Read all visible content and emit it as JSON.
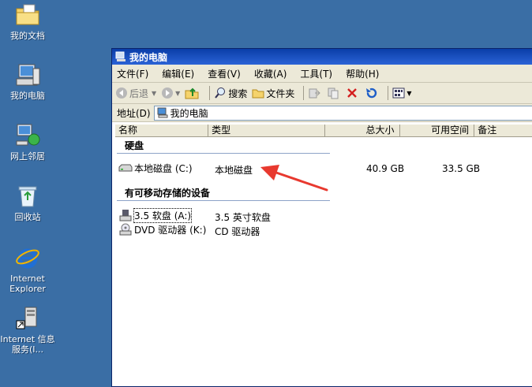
{
  "desktop": {
    "icons": [
      {
        "label": "我的文档"
      },
      {
        "label": "我的电脑"
      },
      {
        "label": "网上邻居"
      },
      {
        "label": "回收站"
      },
      {
        "label": "Internet Explorer"
      },
      {
        "label": "Internet 信息服务(I..."
      }
    ]
  },
  "window": {
    "title": "我的电脑",
    "menu": [
      "文件(F)",
      "编辑(E)",
      "查看(V)",
      "收藏(A)",
      "工具(T)",
      "帮助(H)"
    ],
    "toolbar": {
      "back_label": "后退",
      "search_label": "搜索",
      "folders_label": "文件夹"
    },
    "address": {
      "label": "地址(D)",
      "value": "我的电脑"
    },
    "columns": [
      "名称",
      "类型",
      "总大小",
      "可用空间",
      "备注"
    ],
    "groups": [
      {
        "title": "硬盘",
        "items": [
          {
            "name": "本地磁盘 (C:)",
            "type": "本地磁盘",
            "total": "40.9 GB",
            "free": "33.5 GB"
          }
        ]
      },
      {
        "title": "有可移动存储的设备",
        "items": [
          {
            "name": "3.5 软盘 (A:)",
            "type": "3.5 英寸软盘"
          },
          {
            "name": "DVD 驱动器 (K:)",
            "type": "CD 驱动器"
          }
        ]
      }
    ]
  },
  "colors": {
    "desktop": "#3a6ea5",
    "titlebar": "#0a3ea8",
    "arrow": "#e8392f"
  }
}
